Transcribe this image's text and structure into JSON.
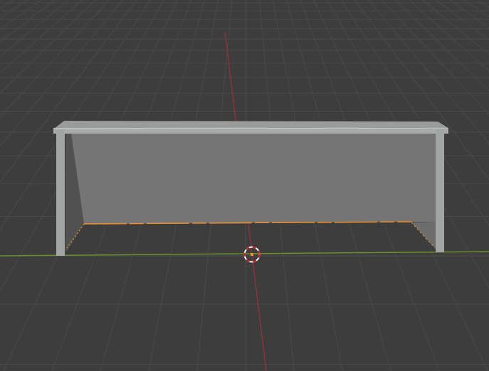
{
  "viewport": {
    "background": "#3d3d3d",
    "grid_color": "#4a4a4a",
    "x_axis_color": "#6a8f2a",
    "y_axis_color": "#9a3040",
    "selection_color": "#f0902a"
  },
  "scene": {
    "object": "soccer-goal",
    "frame_color": "#a9abab",
    "net_color": "#747574",
    "net_side_color": "#555655",
    "cursor_icon": "3d-cursor-icon"
  }
}
